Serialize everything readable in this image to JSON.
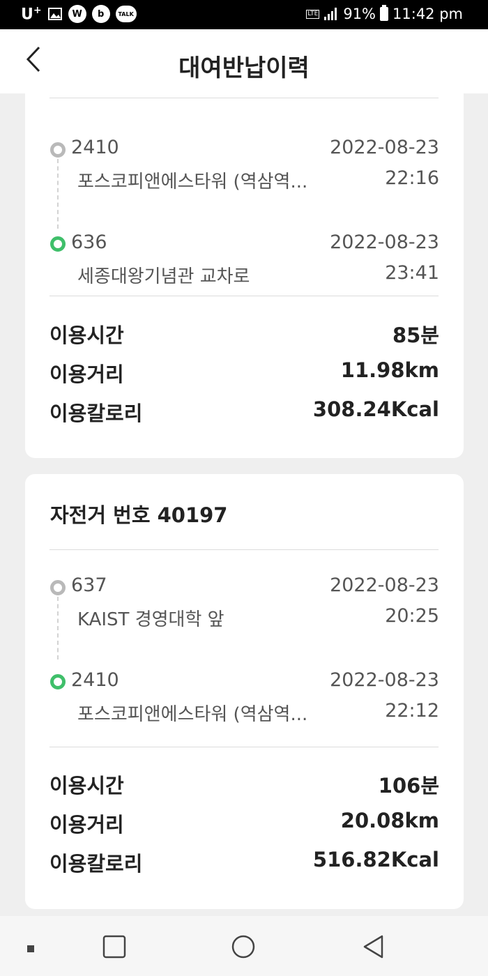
{
  "status_bar": {
    "carrier": "U",
    "carrier_sup": "+",
    "app_icon_w": "W",
    "app_icon_b": "b",
    "app_icon_talk": "TALK",
    "network": "LTE",
    "battery": "91%",
    "time": "11:42 pm"
  },
  "header": {
    "title": "대여반납이력"
  },
  "records": [
    {
      "start": {
        "station": "2410",
        "name": "포스코피앤에스타워 (역삼역...",
        "date": "2022-08-23",
        "time": "22:16"
      },
      "end": {
        "station": "636",
        "name": "세종대왕기념관 교차로",
        "date": "2022-08-23",
        "time": "23:41"
      },
      "stats": [
        {
          "label": "이용시간",
          "value": "85분"
        },
        {
          "label": "이용거리",
          "value": "11.98km"
        },
        {
          "label": "이용칼로리",
          "value": "308.24Kcal"
        }
      ]
    },
    {
      "bike_title": "자전거 번호 40197",
      "start": {
        "station": "637",
        "name": "KAIST 경영대학 앞",
        "date": "2022-08-23",
        "time": "20:25"
      },
      "end": {
        "station": "2410",
        "name": "포스코피앤에스타워 (역삼역...",
        "date": "2022-08-23",
        "time": "22:12"
      },
      "stats": [
        {
          "label": "이용시간",
          "value": "106분"
        },
        {
          "label": "이용거리",
          "value": "20.08km"
        },
        {
          "label": "이용칼로리",
          "value": "516.82Kcal"
        }
      ]
    }
  ],
  "colors": {
    "start_dot": "#b9b9b9",
    "end_dot": "#3fbf6a",
    "background": "#efefef"
  },
  "icons": {
    "back": "chevron-left-icon",
    "nav_recent": "recent-apps-icon",
    "nav_home": "home-icon",
    "nav_back": "back-triangle-icon"
  }
}
